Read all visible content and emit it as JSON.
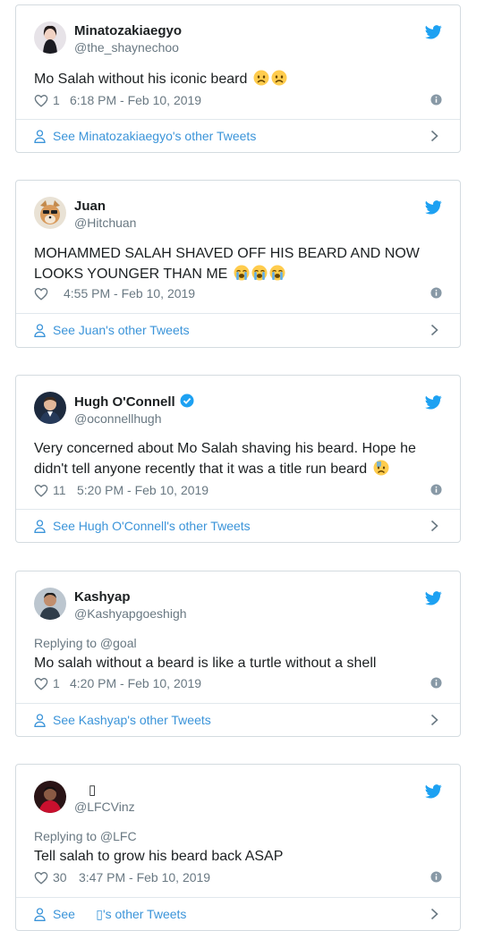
{
  "colors": {
    "twitter_blue": "#1da1f2",
    "link_blue": "#3b94d9",
    "text": "#1c2022",
    "muted": "#697882"
  },
  "other_tweets_prefix": "See ",
  "tweets": [
    {
      "display_name": "Minatozakiaegyo",
      "handle": "@the_shaynechoo",
      "replying_to": "",
      "text": "Mo Salah without his iconic beard",
      "emojis": [
        "worried-face",
        "worried-face"
      ],
      "likes": "1",
      "time": "6:18 PM - Feb 10, 2019",
      "other_tweets": "See Minatozakiaegyo's other Tweets",
      "verified": false
    },
    {
      "display_name": "Juan",
      "handle": "@Hitchuan",
      "replying_to": "",
      "text": "MOHAMMED SALAH SHAVED OFF HIS BEARD AND NOW LOOKS YOUNGER THAN ME",
      "emojis": [
        "loudly-crying-face",
        "loudly-crying-face",
        "loudly-crying-face"
      ],
      "likes": "",
      "time": "4:55 PM - Feb 10, 2019",
      "other_tweets": "See Juan's other Tweets",
      "verified": false
    },
    {
      "display_name": "Hugh O'Connell",
      "handle": "@oconnellhugh",
      "replying_to": "",
      "text": "Very concerned about Mo Salah shaving his beard. Hope he didn't tell anyone recently that it was a title run beard",
      "emojis": [
        "anxious-face-with-sweat"
      ],
      "likes": "11",
      "time": "5:20 PM - Feb 10, 2019",
      "other_tweets": "See Hugh O'Connell's other Tweets",
      "verified": true
    },
    {
      "display_name": "Kashyap",
      "handle": "@Kashyapgoeshigh",
      "replying_to": "Replying to @goal",
      "text": "Mo salah without a beard is like a turtle without a shell",
      "emojis": [],
      "likes": "1",
      "time": "4:20 PM - Feb 10, 2019",
      "other_tweets": "See Kashyap's other Tweets",
      "verified": false
    },
    {
      "display_name": "▯",
      "handle": "@LFCVinz",
      "replying_to": "Replying to @LFC",
      "text": "Tell salah to grow his beard back ASAP",
      "emojis": [],
      "likes": "30",
      "time": "3:47 PM - Feb 10, 2019",
      "other_tweets": "See      ▯'s other Tweets",
      "verified": false
    }
  ]
}
